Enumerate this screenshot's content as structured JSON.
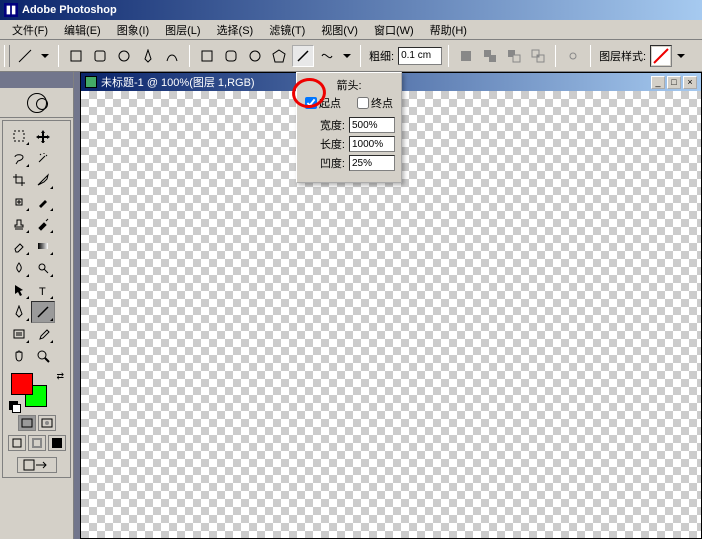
{
  "app": {
    "title": "Adobe Photoshop"
  },
  "menu": {
    "file": "文件(F)",
    "edit": "编辑(E)",
    "image": "图象(I)",
    "layer": "图层(L)",
    "select": "选择(S)",
    "filter": "滤镜(T)",
    "view": "视图(V)",
    "window": "窗口(W)",
    "help": "帮助(H)"
  },
  "options": {
    "weight_label": "粗细:",
    "weight_value": "0.1 cm",
    "layer_style_label": "图层样式:"
  },
  "doc": {
    "title": "未标题-1 @ 100%(图层 1,RGB)"
  },
  "flyout": {
    "caption": "箭头:",
    "start_label": "起点",
    "start_checked": true,
    "end_label": "终点",
    "end_checked": false,
    "width_label": "宽度:",
    "width_value": "500%",
    "length_label": "长度:",
    "length_value": "1000%",
    "concave_label": "凹度:",
    "concave_value": "25%"
  },
  "colors": {
    "fg": "#ff0000",
    "bg": "#00ff00"
  }
}
